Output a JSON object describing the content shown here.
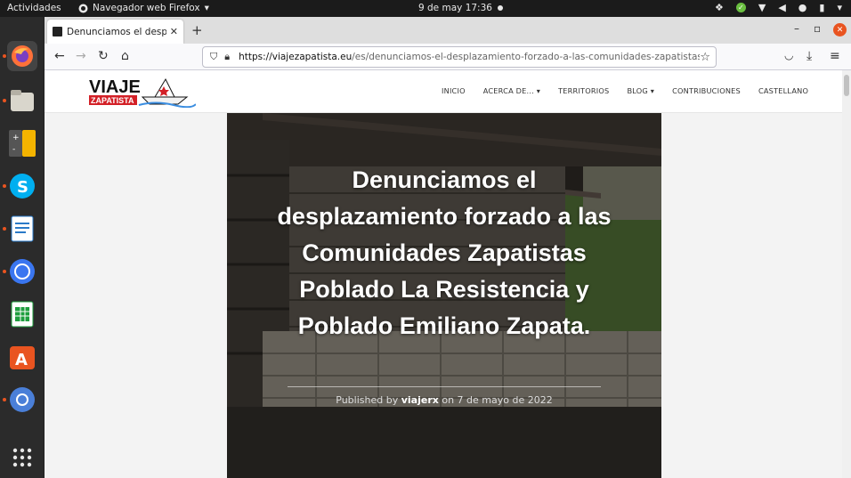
{
  "topbar": {
    "activities": "Actividades",
    "app_name": "Navegador web Firefox",
    "clock": "9 de may  17:36"
  },
  "dock": {
    "items": [
      "firefox-icon",
      "files-icon",
      "calculator-icon",
      "skype-icon",
      "writer-icon",
      "signal-icon",
      "calc-spreadsheet-icon",
      "software-icon",
      "chromium-icon",
      "app-grid-icon"
    ]
  },
  "browser": {
    "tab_title": "Denunciamos el desplaza",
    "new_tab": "+",
    "url_domain": "https://viajezapatista.eu",
    "url_path": "/es/denunciamos-el-desplazamiento-forzado-a-las-comunidades-zapatistas-p"
  },
  "site": {
    "logo_text_top": "VIAJE",
    "logo_text_bottom": "ZAPATISTA",
    "menu": [
      "INICIO",
      "ACERCA DE...",
      "TERRITORIOS",
      "BLOG",
      "CONTRIBUCIONES",
      "CASTELLANO"
    ]
  },
  "article": {
    "title": "Denunciamos el desplazamiento forzado a las Comunidades Zapatistas Poblado La Resistencia y Poblado Emiliano Zapata.",
    "published_by": "Published by",
    "author": "viajerx",
    "date_prefix": "on",
    "date": "7 de mayo de 2022"
  },
  "colors": {
    "accent": "#e95420",
    "logo_red": "#d32027"
  }
}
